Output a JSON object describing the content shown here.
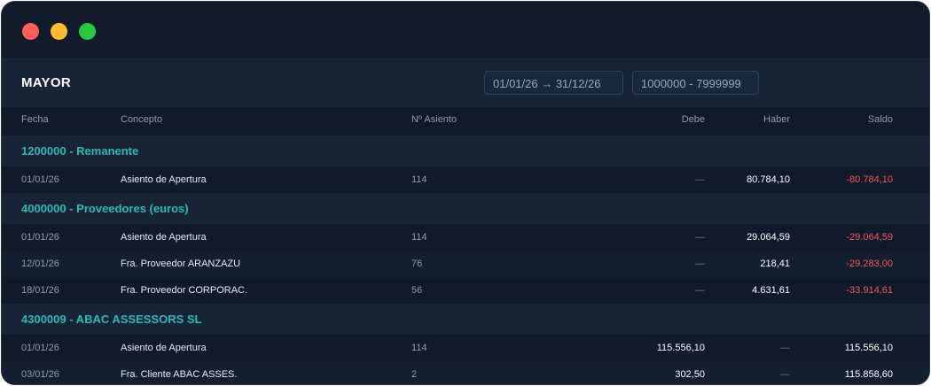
{
  "title": "MAYOR",
  "filters": {
    "date_range": "01/01/26 → 31/12/26",
    "account_range": "1000000 - 7999999"
  },
  "columns": {
    "fecha": "Fecha",
    "concepto": "Concepto",
    "asiento": "Nº Asiento",
    "debe": "Debe",
    "haber": "Haber",
    "saldo": "Saldo"
  },
  "accounts": [
    {
      "name": "1200000 - Remanente",
      "rows": [
        {
          "fecha": "01/01/26",
          "concepto": "Asiento de Apertura",
          "asiento": "114",
          "debe": "—",
          "haber": "80.784,10",
          "saldo": "-80.784,10"
        }
      ]
    },
    {
      "name": "4000000 - Proveedores (euros)",
      "rows": [
        {
          "fecha": "01/01/26",
          "concepto": "Asiento de Apertura",
          "asiento": "114",
          "debe": "—",
          "haber": "29.064,59",
          "saldo": "-29.064,59"
        },
        {
          "fecha": "12/01/26",
          "concepto": "Fra. Proveedor ARANZAZU",
          "asiento": "76",
          "debe": "—",
          "haber": "218,41",
          "saldo": "-29.283,00"
        },
        {
          "fecha": "18/01/26",
          "concepto": "Fra. Proveedor CORPORAC.",
          "asiento": "56",
          "debe": "—",
          "haber": "4.631,61",
          "saldo": "-33.914,61"
        }
      ]
    },
    {
      "name": "4300009 - ABAC ASSESSORS SL",
      "rows": [
        {
          "fecha": "01/01/26",
          "concepto": "Asiento de Apertura",
          "asiento": "114",
          "debe": "115.556,10",
          "haber": "—",
          "saldo": "115.556,10"
        },
        {
          "fecha": "03/01/26",
          "concepto": "Fra. Cliente ABAC ASSES.",
          "asiento": "2",
          "debe": "302,50",
          "haber": "—",
          "saldo": "115.858,60"
        }
      ]
    }
  ]
}
